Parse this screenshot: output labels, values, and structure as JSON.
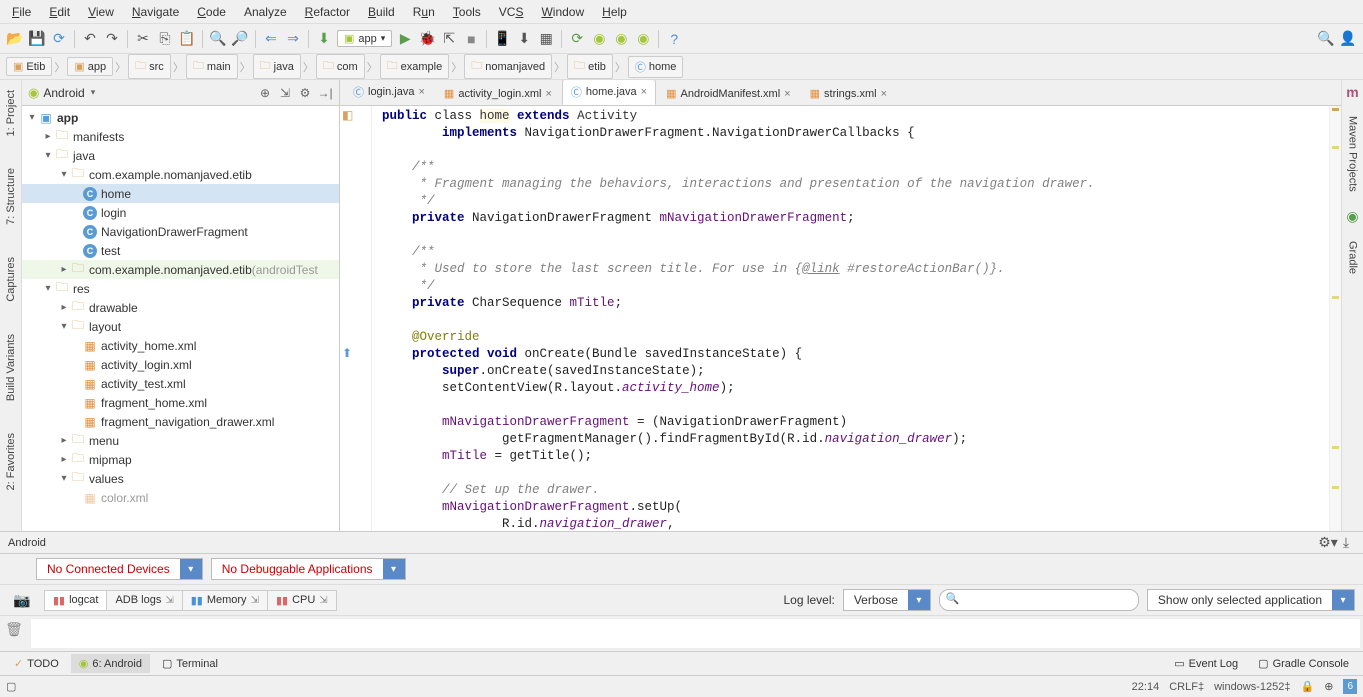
{
  "menu": {
    "file": "File",
    "edit": "Edit",
    "view": "View",
    "navigate": "Navigate",
    "code": "Code",
    "analyze": "Analyze",
    "refactor": "Refactor",
    "build": "Build",
    "run": "Run",
    "tools": "Tools",
    "vcs": "VCS",
    "window": "Window",
    "help": "Help"
  },
  "toolbar": {
    "run_config": "app"
  },
  "breadcrumb": [
    "Etib",
    "app",
    "src",
    "main",
    "java",
    "com",
    "example",
    "nomanjaved",
    "etib",
    "home"
  ],
  "project_panel": {
    "title": "Android"
  },
  "tree": {
    "app": "app",
    "manifests": "manifests",
    "java": "java",
    "pkg1": "com.example.nomanjaved.etib",
    "home": "home",
    "login": "login",
    "ndf": "NavigationDrawerFragment",
    "test": "test",
    "pkg2": "com.example.nomanjaved.etib",
    "pkg2_suffix": " (androidTest",
    "res": "res",
    "drawable": "drawable",
    "layout": "layout",
    "act_home": "activity_home.xml",
    "act_login": "activity_login.xml",
    "act_test": "activity_test.xml",
    "frag_home": "fragment_home.xml",
    "frag_nav": "fragment_navigation_drawer.xml",
    "menu": "menu",
    "mipmap": "mipmap",
    "values": "values",
    "color": "color.xml"
  },
  "tabs": {
    "login": "login.java",
    "activity_login": "activity_login.xml",
    "home": "home.java",
    "manifest": "AndroidManifest.xml",
    "strings": "strings.xml"
  },
  "code": {
    "l1a": "public",
    "l1b": " class ",
    "l1c": "home",
    "l1d": " extends ",
    "l1e": "Activity",
    "l2a": "        implements ",
    "l2b": "NavigationDrawerFragment.NavigationDrawerCallbacks {",
    "l3": "",
    "l4": "    /**",
    "l5": "     * Fragment managing the behaviors, interactions and presentation of the navigation drawer.",
    "l6": "     */",
    "l7a": "    private ",
    "l7b": "NavigationDrawerFragment ",
    "l7c": "mNavigationDrawerFragment",
    "l7d": ";",
    "l8": "",
    "l9": "    /**",
    "l10a": "     * Used to store the last screen title. For use in {",
    "l10b": "@link",
    "l10c": " #restoreActionBar()}.",
    "l11": "     */",
    "l12a": "    private ",
    "l12b": "CharSequence ",
    "l12c": "mTitle",
    "l12d": ";",
    "l13": "",
    "l14": "    @Override",
    "l15a": "    protected ",
    "l15b": "void ",
    "l15c": "onCreate(Bundle savedInstanceState) {",
    "l16a": "        super",
    "l16b": ".onCreate(savedInstanceState);",
    "l17a": "        setContentView(R.layout.",
    "l17b": "activity_home",
    "l17c": ");",
    "l18": "",
    "l19a": "        ",
    "l19b": "mNavigationDrawerFragment",
    "l19c": " = (NavigationDrawerFragment)",
    "l20a": "                getFragmentManager().findFragmentById(R.id.",
    "l20b": "navigation_drawer",
    "l20c": ");",
    "l21a": "        ",
    "l21b": "mTitle",
    "l21c": " = getTitle();",
    "l22": "",
    "l23": "        // Set up the drawer.",
    "l24a": "        ",
    "l24b": "mNavigationDrawerFragment",
    "l24c": ".setUp(",
    "l25a": "                R.id.",
    "l25b": "navigation_drawer",
    "l25c": ","
  },
  "left_tabs": {
    "project": "1: Project",
    "structure": "7: Structure",
    "captures": "Captures",
    "build_variants": "Build Variants",
    "favorites": "2: Favorites"
  },
  "right_tabs": {
    "maven": "Maven Projects",
    "gradle": "Gradle"
  },
  "android_panel": {
    "title": "Android",
    "devices": "No Connected Devices",
    "debuggable": "No Debuggable Applications",
    "tab_logcat": "logcat",
    "tab_adb": "ADB logs",
    "tab_memory": "Memory",
    "tab_cpu": "CPU",
    "log_level_label": "Log level:",
    "log_level": "Verbose",
    "filter": "Show only selected application"
  },
  "bottom_tabs": {
    "todo": "TODO",
    "android": "6: Android",
    "terminal": "Terminal",
    "event_log": "Event Log",
    "gradle_console": "Gradle Console"
  },
  "status": {
    "time": "22:14",
    "sep": "CRLF",
    "enc": "windows-1252"
  }
}
